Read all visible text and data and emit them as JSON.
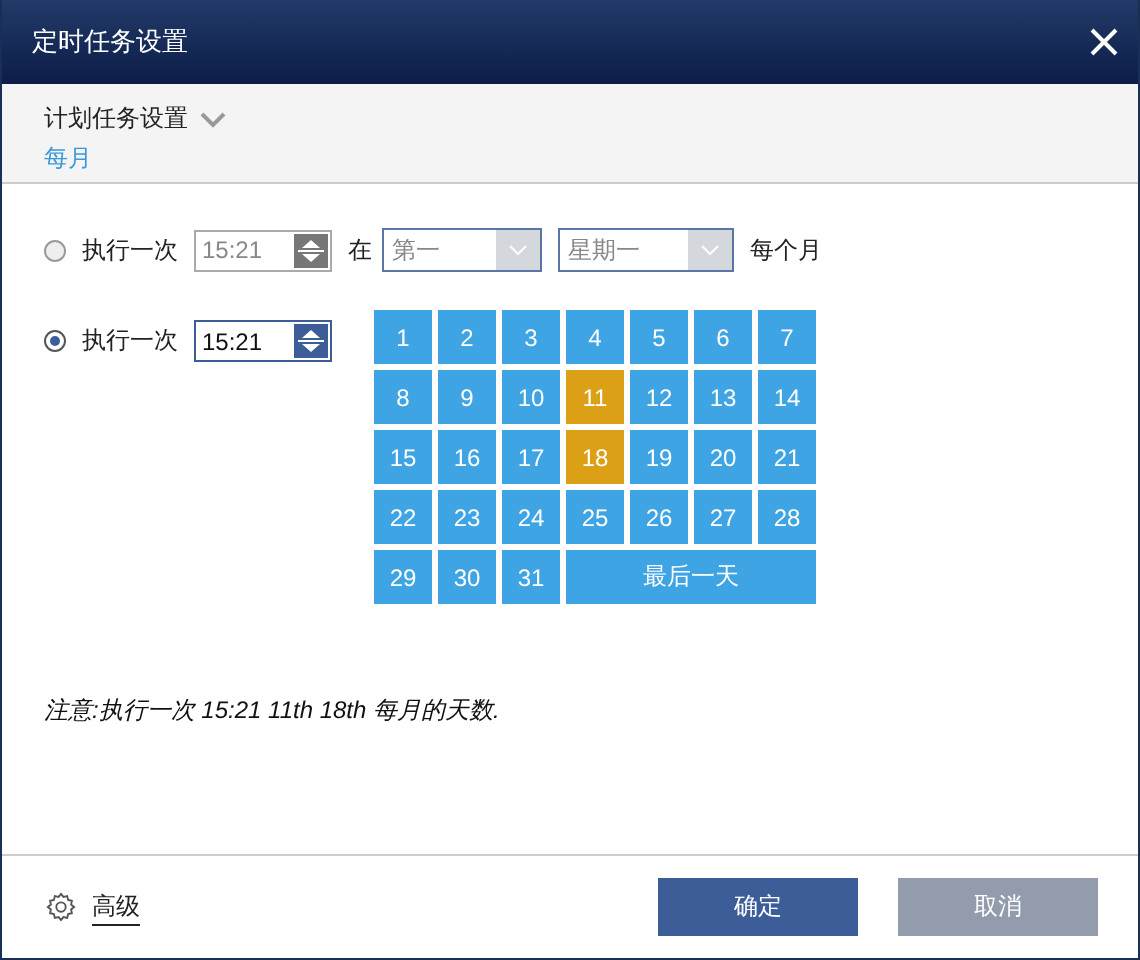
{
  "window": {
    "title": "定时任务设置"
  },
  "header": {
    "label": "计划任务设置",
    "value": "每月"
  },
  "options": [
    {
      "kind": "weekday",
      "label": "执行一次",
      "selected": false,
      "time": "15:21",
      "at": "在",
      "ordinal": "第一",
      "weekday": "星期一",
      "suffix": "每个月"
    },
    {
      "kind": "days",
      "label": "执行一次",
      "selected": true,
      "time": "15:21"
    }
  ],
  "days": [
    {
      "label": "1",
      "selected": false
    },
    {
      "label": "2",
      "selected": false
    },
    {
      "label": "3",
      "selected": false
    },
    {
      "label": "4",
      "selected": false
    },
    {
      "label": "5",
      "selected": false
    },
    {
      "label": "6",
      "selected": false
    },
    {
      "label": "7",
      "selected": false
    },
    {
      "label": "8",
      "selected": false
    },
    {
      "label": "9",
      "selected": false
    },
    {
      "label": "10",
      "selected": false
    },
    {
      "label": "11",
      "selected": true
    },
    {
      "label": "12",
      "selected": false
    },
    {
      "label": "13",
      "selected": false
    },
    {
      "label": "14",
      "selected": false
    },
    {
      "label": "15",
      "selected": false
    },
    {
      "label": "16",
      "selected": false
    },
    {
      "label": "17",
      "selected": false
    },
    {
      "label": "18",
      "selected": true
    },
    {
      "label": "19",
      "selected": false
    },
    {
      "label": "20",
      "selected": false
    },
    {
      "label": "21",
      "selected": false
    },
    {
      "label": "22",
      "selected": false
    },
    {
      "label": "23",
      "selected": false
    },
    {
      "label": "24",
      "selected": false
    },
    {
      "label": "25",
      "selected": false
    },
    {
      "label": "26",
      "selected": false
    },
    {
      "label": "27",
      "selected": false
    },
    {
      "label": "28",
      "selected": false
    },
    {
      "label": "29",
      "selected": false
    },
    {
      "label": "30",
      "selected": false
    },
    {
      "label": "31",
      "selected": false
    },
    {
      "label": "最后一天",
      "selected": false
    }
  ],
  "note": "注意:执行一次 15:21 11th 18th 每月的天数.",
  "advanced": "高级",
  "buttons": [
    {
      "label": "确定",
      "kind": "primary"
    },
    {
      "label": "取消",
      "kind": "secondary"
    }
  ]
}
